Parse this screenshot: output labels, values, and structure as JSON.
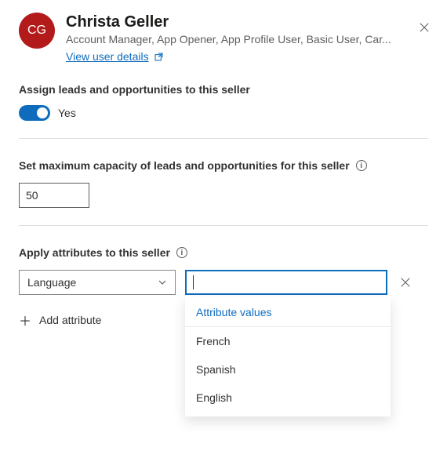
{
  "user": {
    "initials": "CG",
    "name": "Christa Geller",
    "roles": "Account Manager, App Opener, App Profile User, Basic User, Car...",
    "details_link": "View user details"
  },
  "assign": {
    "label": "Assign leads and opportunities to this seller",
    "toggle_value": "Yes"
  },
  "capacity": {
    "label": "Set maximum capacity of leads and opportunities for this seller",
    "value": "50"
  },
  "attributes": {
    "label": "Apply attributes to this seller",
    "selected_key": "Language",
    "value_input": "",
    "dropdown_header": "Attribute values",
    "options": {
      "0": "French",
      "1": "Spanish",
      "2": "English"
    },
    "add_label": "Add attribute"
  }
}
